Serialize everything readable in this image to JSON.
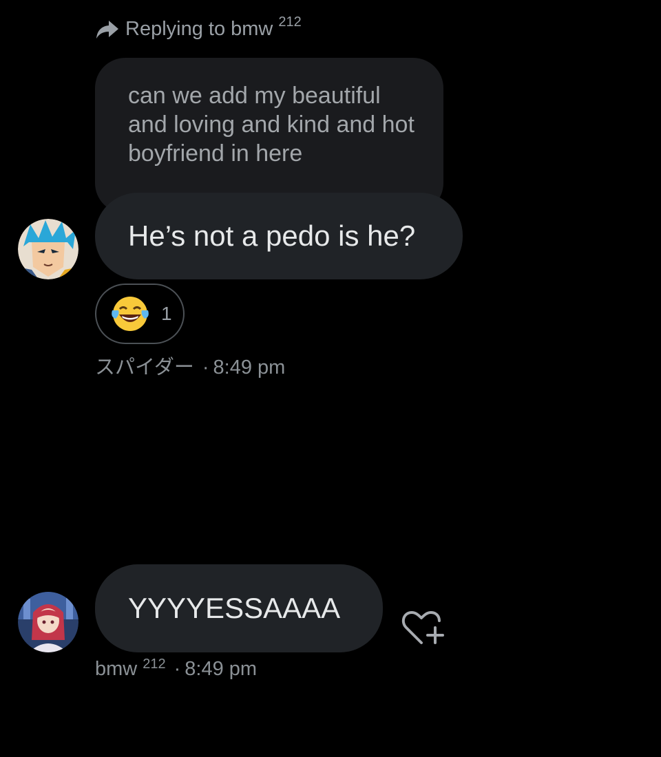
{
  "reply_header": {
    "label": "Replying to bmw",
    "superscript": "212",
    "icon": "reply-arrow-icon"
  },
  "quoted_message": {
    "text": "can we add my beautiful and loving and kind and hot boyfriend in here"
  },
  "messages": [
    {
      "text": "He’s not a pedo is he?",
      "avatar": "anime-character-avatar",
      "reaction": {
        "emoji": "face-with-tears-of-joy-icon",
        "count": "1"
      },
      "sender": "スパイダー",
      "separator": "·",
      "time": "8:49 pm"
    },
    {
      "text": "YYYYESSAAAA",
      "avatar": "anime-girl-avatar",
      "sender": "bmw",
      "sender_superscript": "212",
      "separator": "·",
      "time": "8:49 pm",
      "action_icon": "add-reaction-heart-icon"
    }
  ],
  "colors": {
    "background": "#000000",
    "bubble": "#202327",
    "quoted_bubble": "#1a1b1e",
    "muted_text": "#8b9196"
  }
}
